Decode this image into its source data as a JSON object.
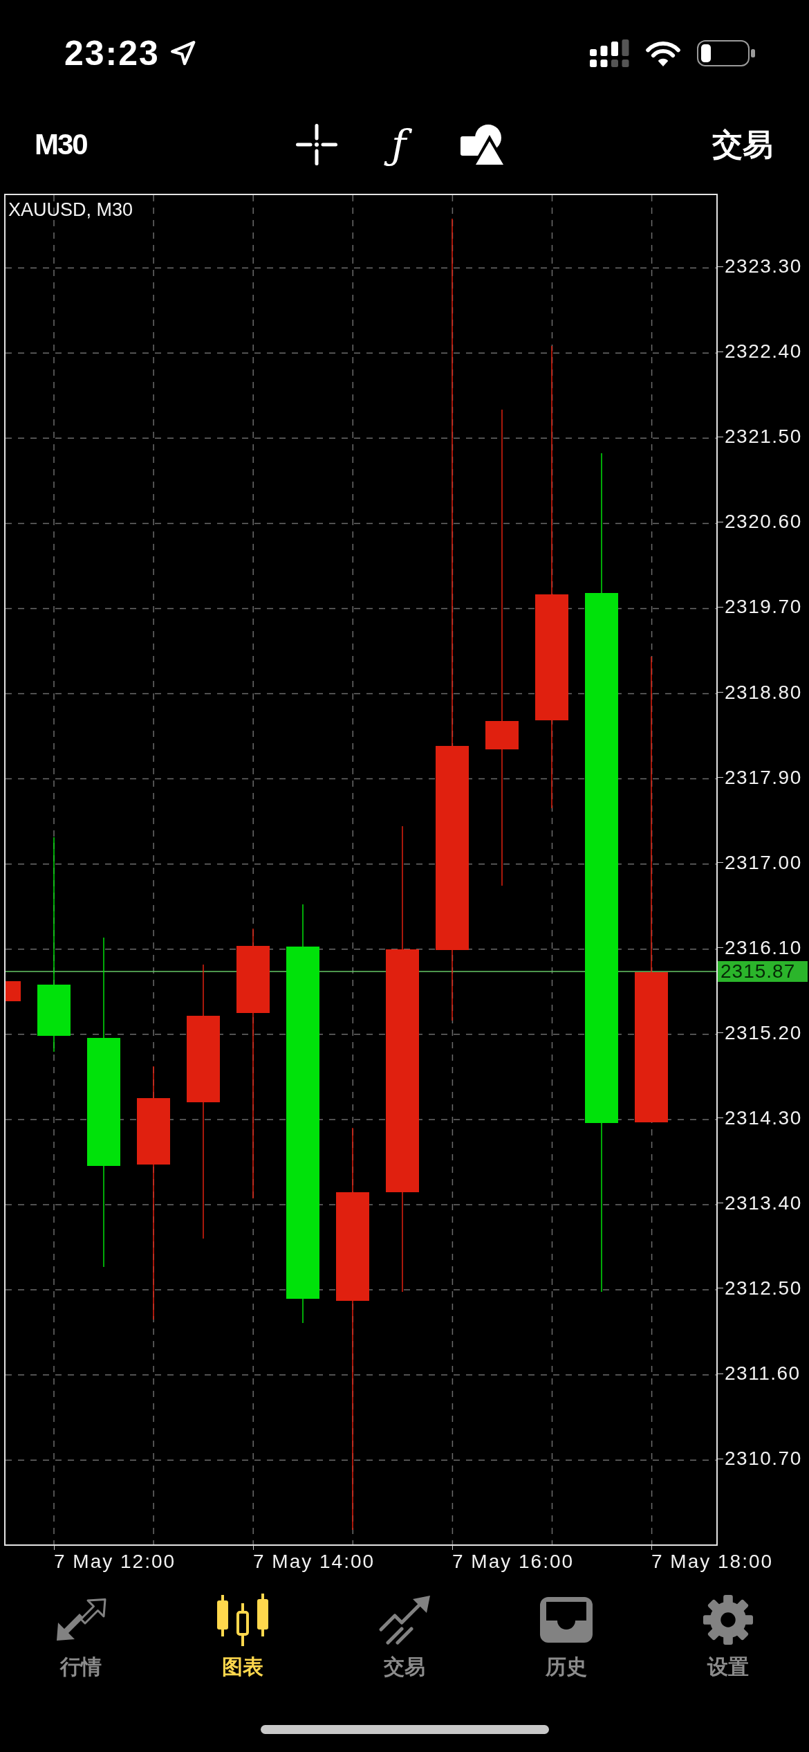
{
  "status_bar": {
    "time": "23:23"
  },
  "toolbar": {
    "timeframe": "M30",
    "function_button": "ƒ",
    "trade_button": "交易"
  },
  "chart": {
    "symbol": "XAUUSD, M30",
    "price_labels": [
      "2323.30",
      "2322.40",
      "2321.50",
      "2320.60",
      "2319.70",
      "2318.80",
      "2317.90",
      "2317.00",
      "2316.10",
      "2315.20",
      "2314.30",
      "2313.40",
      "2312.50",
      "2311.60",
      "2310.70"
    ],
    "time_labels": [
      "7 May 12:00",
      "7 May 14:00",
      "7 May 16:00",
      "7 May 18:00"
    ],
    "current_price": "2315.87",
    "candles": [
      {
        "color": "#e0200f"
      },
      {
        "color": "#00e20a"
      },
      {
        "color": "#00e20a"
      },
      {
        "color": "#e0200f"
      },
      {
        "color": "#e0200f"
      },
      {
        "color": "#e0200f"
      },
      {
        "color": "#00e20a"
      },
      {
        "color": "#e0200f"
      },
      {
        "color": "#e0200f"
      },
      {
        "color": "#e0200f"
      },
      {
        "color": "#e0200f"
      },
      {
        "color": "#e0200f"
      },
      {
        "color": "#00e20a"
      },
      {
        "color": "#e0200f"
      }
    ]
  },
  "tab_bar": {
    "tabs": [
      {
        "label": "行情",
        "selected": false
      },
      {
        "label": "图表",
        "selected": true
      },
      {
        "label": "交易",
        "selected": false
      },
      {
        "label": "历史",
        "selected": false
      },
      {
        "label": "设置",
        "selected": false
      }
    ]
  }
}
